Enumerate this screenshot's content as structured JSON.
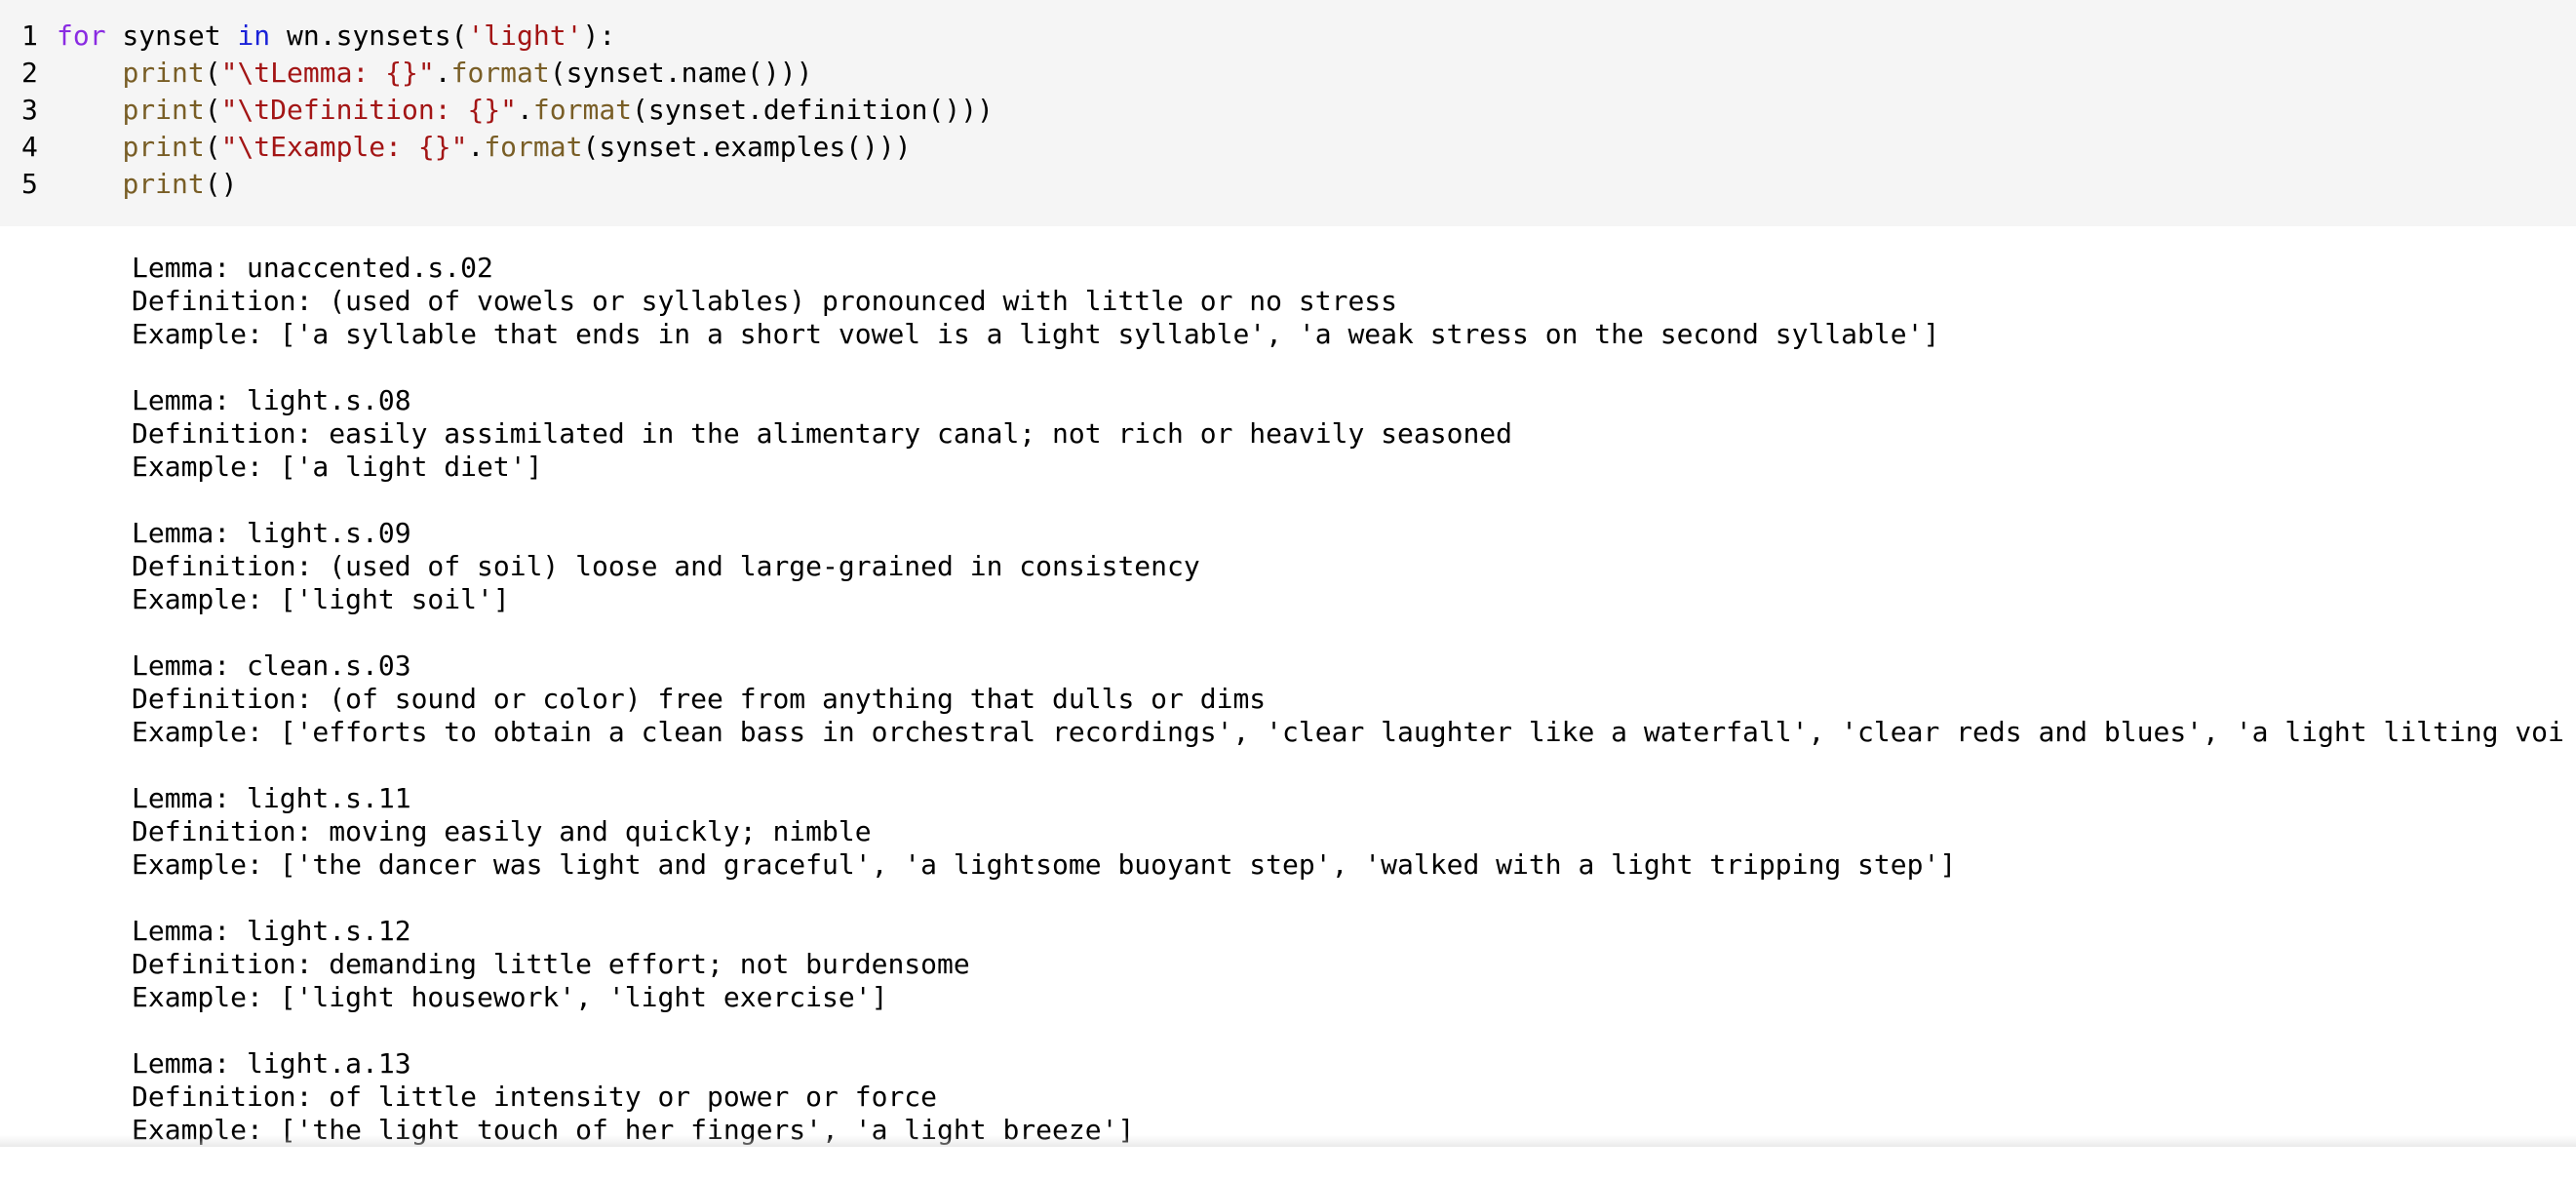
{
  "code": {
    "lines": [
      {
        "num": "1",
        "tokens": [
          {
            "t": "for",
            "c": "kw"
          },
          {
            "t": " synset ",
            "c": "plain"
          },
          {
            "t": "in",
            "c": "kw2"
          },
          {
            "t": " wn.synsets(",
            "c": "plain"
          },
          {
            "t": "'light'",
            "c": "str"
          },
          {
            "t": "):",
            "c": "plain"
          }
        ]
      },
      {
        "num": "2",
        "tokens": [
          {
            "t": "    ",
            "c": "plain"
          },
          {
            "t": "print",
            "c": "fn"
          },
          {
            "t": "(",
            "c": "plain"
          },
          {
            "t": "\"\\tLemma: {}\"",
            "c": "str"
          },
          {
            "t": ".",
            "c": "plain"
          },
          {
            "t": "format",
            "c": "fn"
          },
          {
            "t": "(synset.name()))",
            "c": "plain"
          }
        ]
      },
      {
        "num": "3",
        "tokens": [
          {
            "t": "    ",
            "c": "plain"
          },
          {
            "t": "print",
            "c": "fn"
          },
          {
            "t": "(",
            "c": "plain"
          },
          {
            "t": "\"\\tDefinition: {}\"",
            "c": "str"
          },
          {
            "t": ".",
            "c": "plain"
          },
          {
            "t": "format",
            "c": "fn"
          },
          {
            "t": "(synset.definition()))",
            "c": "plain"
          }
        ]
      },
      {
        "num": "4",
        "tokens": [
          {
            "t": "    ",
            "c": "plain"
          },
          {
            "t": "print",
            "c": "fn"
          },
          {
            "t": "(",
            "c": "plain"
          },
          {
            "t": "\"\\tExample: {}\"",
            "c": "str"
          },
          {
            "t": ".",
            "c": "plain"
          },
          {
            "t": "format",
            "c": "fn"
          },
          {
            "t": "(synset.examples()))",
            "c": "plain"
          }
        ]
      },
      {
        "num": "5",
        "tokens": [
          {
            "t": "    ",
            "c": "plain"
          },
          {
            "t": "print",
            "c": "fn"
          },
          {
            "t": "()",
            "c": "plain"
          }
        ]
      }
    ]
  },
  "output": {
    "entries": [
      {
        "lemma": "Lemma: unaccented.s.02",
        "definition": "Definition: (used of vowels or syllables) pronounced with little or no stress",
        "example": "Example: ['a syllable that ends in a short vowel is a light syllable', 'a weak stress on the second syllable']"
      },
      {
        "lemma": "Lemma: light.s.08",
        "definition": "Definition: easily assimilated in the alimentary canal; not rich or heavily seasoned",
        "example": "Example: ['a light diet']"
      },
      {
        "lemma": "Lemma: light.s.09",
        "definition": "Definition: (used of soil) loose and large-grained in consistency",
        "example": "Example: ['light soil']"
      },
      {
        "lemma": "Lemma: clean.s.03",
        "definition": "Definition: (of sound or color) free from anything that dulls or dims",
        "example": "Example: ['efforts to obtain a clean bass in orchestral recordings', 'clear laughter like a waterfall', 'clear reds and blues', 'a light lilting voi"
      },
      {
        "lemma": "Lemma: light.s.11",
        "definition": "Definition: moving easily and quickly; nimble",
        "example": "Example: ['the dancer was light and graceful', 'a lightsome buoyant step', 'walked with a light tripping step']"
      },
      {
        "lemma": "Lemma: light.s.12",
        "definition": "Definition: demanding little effort; not burdensome",
        "example": "Example: ['light housework', 'light exercise']"
      },
      {
        "lemma": "Lemma: light.a.13",
        "definition": "Definition: of little intensity or power or force",
        "example": "Example: ['the light touch of her fingers', 'a light breeze']"
      }
    ]
  }
}
